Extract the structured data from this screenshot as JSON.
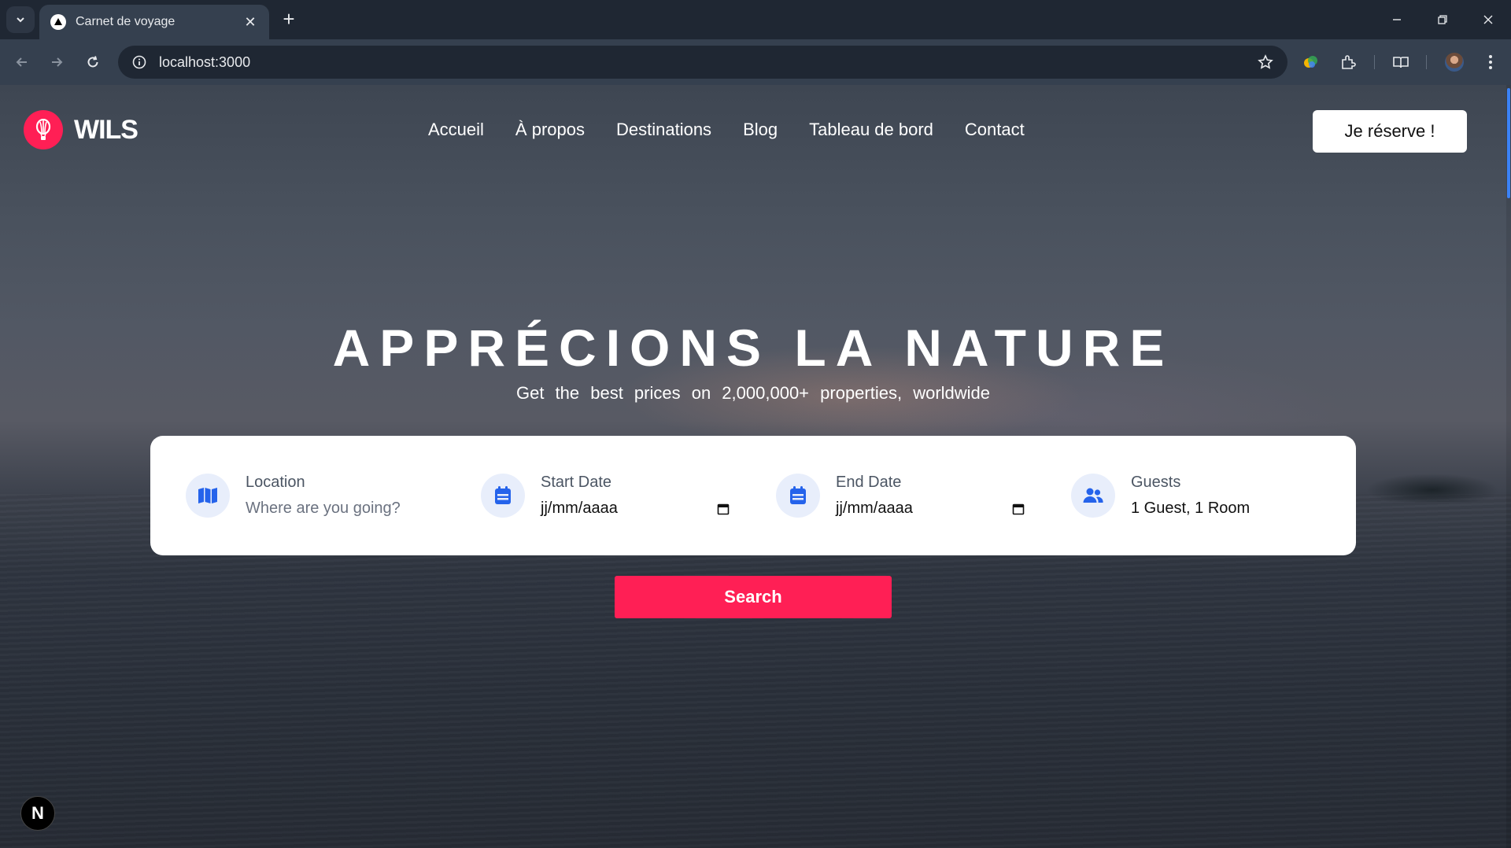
{
  "browser": {
    "tab_title": "Carnet de voyage",
    "tab_close": "✕",
    "new_tab": "+",
    "url": "localhost:3000"
  },
  "site": {
    "logo_text": "WILS",
    "nav": [
      "Accueil",
      "À propos",
      "Destinations",
      "Blog",
      "Tableau de bord",
      "Contact"
    ],
    "reserve_label": "Je réserve !"
  },
  "hero": {
    "title": "APPRÉCIONS LA NATURE",
    "subtitle": "Get the best prices on 2,000,000+ properties, worldwide"
  },
  "search": {
    "location_label": "Location",
    "location_placeholder": "Where are you going?",
    "start_label": "Start Date",
    "start_value": "jj/mm/aaaa",
    "end_label": "End Date",
    "end_value": "jj/mm/aaaa",
    "guests_label": "Guests",
    "guests_value": "1 Guest, 1 Room",
    "button_label": "Search"
  },
  "next_badge": "N",
  "colors": {
    "brand": "#ff1f55",
    "icon_blue": "#2563eb",
    "icon_bg": "#e8eefb",
    "chrome_dark": "#1f2733",
    "chrome_mid": "#35404f"
  }
}
